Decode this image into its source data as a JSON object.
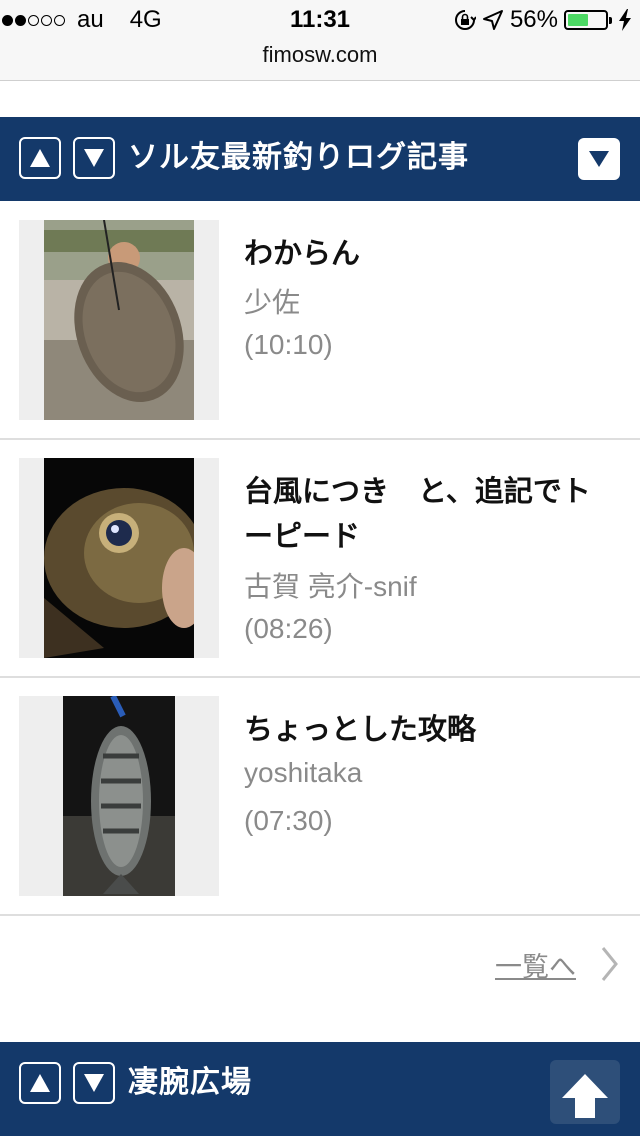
{
  "status_bar": {
    "signal_filled": 2,
    "signal_total": 5,
    "carrier": "au",
    "network": "4G",
    "time": "11:31",
    "battery_percent": "56%",
    "battery_level": 0.56,
    "icons": [
      "orientation-lock-icon",
      "location-arrow-icon",
      "battery-icon",
      "charging-bolt-icon"
    ]
  },
  "url_bar": {
    "domain": "fimosw.com"
  },
  "colors": {
    "header_bg": "#14396a",
    "text_gray": "#8a8a8a",
    "battery_green": "#4cd964"
  },
  "section1": {
    "title": "ソル友最新釣りログ記事",
    "articles": [
      {
        "title": "わからん",
        "author": "少佐",
        "time": "(10:10)",
        "image": "angler-holding-flounder-photo"
      },
      {
        "title": "台風につき　と、追記でトーピード",
        "author": "古賀 亮介-snif",
        "time": "(08:26)",
        "image": "rockfish-closeup-photo"
      },
      {
        "title": "ちょっとした攻略",
        "author": "yoshitaka",
        "time": "(07:30)",
        "image": "black-seabream-hanging-photo"
      }
    ],
    "more_link": "一覧へ"
  },
  "section2": {
    "title": "凄腕広場"
  }
}
